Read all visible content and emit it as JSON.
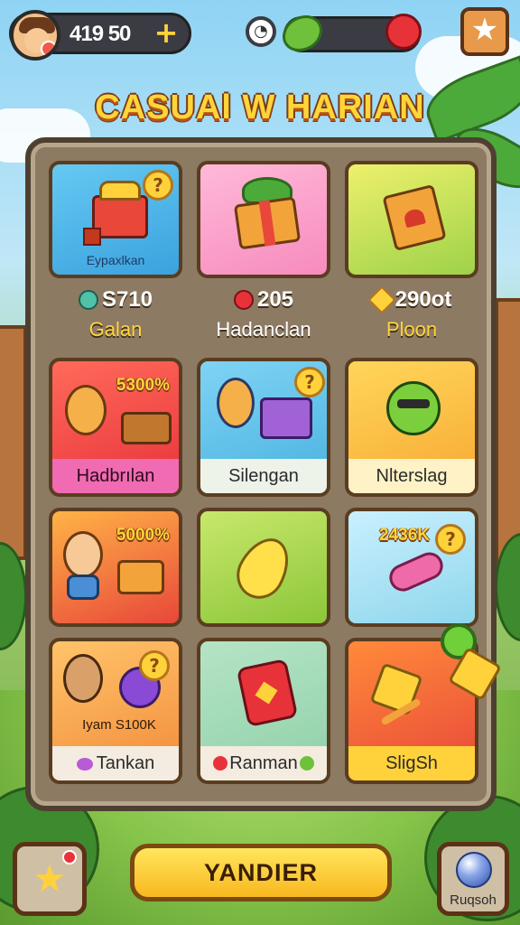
{
  "topbar": {
    "coins": "419 50",
    "plus_label": "+",
    "timer_symbol": "◔",
    "energy_level": 0.2,
    "star_symbol": "★"
  },
  "title": "CASUAl W HARIAN",
  "top_tiles": [
    {
      "caption": "Eypaxlkan"
    }
  ],
  "stats": [
    {
      "value": "S710",
      "name": "Galan"
    },
    {
      "value": "205",
      "name": "Hadanclan"
    },
    {
      "value": "290ot",
      "name": "Ploon"
    }
  ],
  "row2": [
    {
      "pct": "5300%",
      "label": "Hadbrılan"
    },
    {
      "label": "Silengan"
    },
    {
      "label": "Nlterslag"
    }
  ],
  "row3": [
    {
      "pct": "5000%"
    },
    {},
    {
      "pct": "2436K"
    }
  ],
  "row4": [
    {
      "inner_text": "Iyam  S100K",
      "label": "Tankan"
    },
    {
      "label": "Ranman"
    },
    {
      "label": "SligSh"
    }
  ],
  "qmark": "?",
  "bottom": {
    "main_button": "YANDIER",
    "right_label": "Ruqsoh",
    "left_symbol": "★"
  }
}
